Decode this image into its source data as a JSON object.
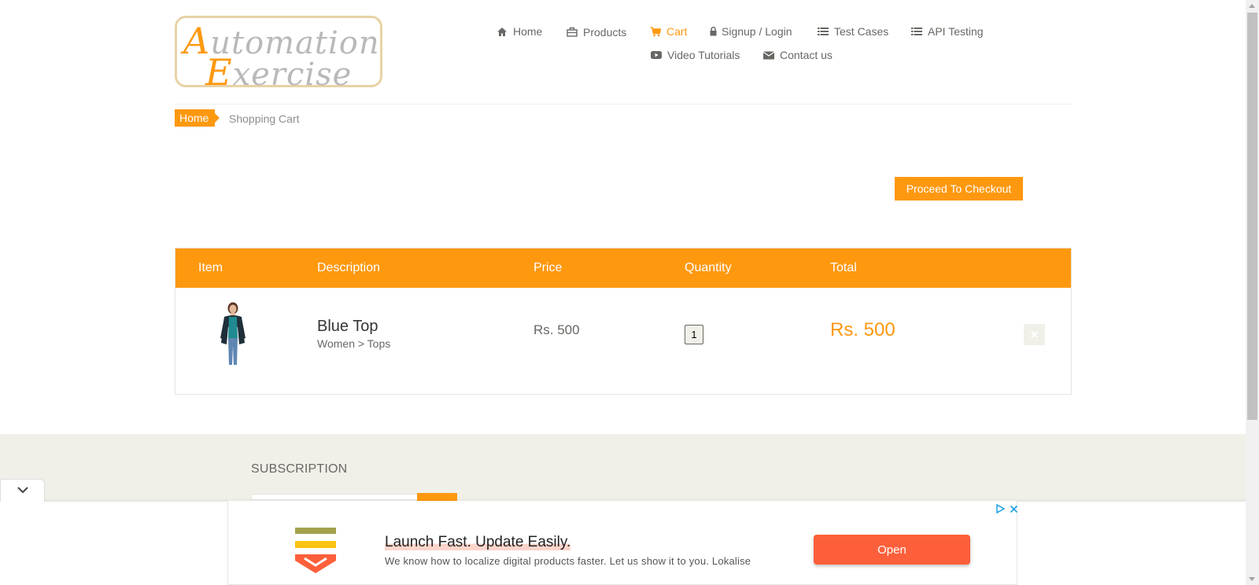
{
  "logo": {
    "line1_cap": "A",
    "line1_rest": "utomation",
    "line2_cap": "E",
    "line2_rest": "xercise"
  },
  "nav": {
    "home": "Home",
    "products": "Products",
    "cart": "Cart",
    "signup_login": "Signup / Login",
    "test_cases": "Test Cases",
    "api_testing": "API Testing",
    "video_tutorials": "Video Tutorials",
    "contact_us": "Contact us"
  },
  "breadcrumb": {
    "home": "Home",
    "current": "Shopping Cart"
  },
  "checkout_button": "Proceed To Checkout",
  "cart": {
    "headers": {
      "item": "Item",
      "description": "Description",
      "price": "Price",
      "quantity": "Quantity",
      "total": "Total"
    },
    "rows": [
      {
        "name": "Blue Top",
        "category": "Women > Tops",
        "price": "Rs. 500",
        "quantity": "1",
        "total": "Rs. 500"
      }
    ]
  },
  "footer": {
    "subscription_title": "SUBSCRIPTION"
  },
  "ad": {
    "headline": "Launch Fast. Update Easily.",
    "description": "We know how to localize digital products faster. Let us show it to you. Lokalise",
    "button": "Open"
  },
  "colors": {
    "accent": "#fe980f",
    "text": "#696763",
    "footer_bg": "#f0f0e9",
    "ad_button": "#fe5f3b"
  }
}
